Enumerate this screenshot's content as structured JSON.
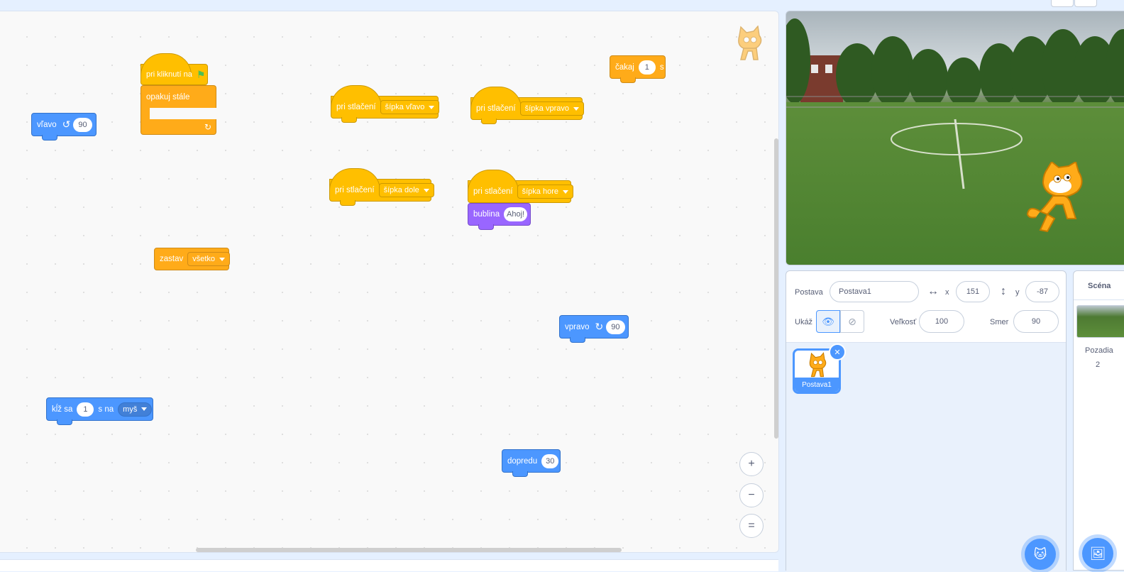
{
  "code_blocks": {
    "turn_left": {
      "label": "vľavo",
      "value": "90"
    },
    "when_flag": {
      "label": "pri kliknutí na"
    },
    "forever": {
      "label": "opakuj stále"
    },
    "wait": {
      "label": "čakaj",
      "value": "1",
      "unit": "s"
    },
    "key_left": {
      "label": "pri stlačení",
      "key": "šípka vľavo"
    },
    "key_right": {
      "label": "pri stlačení",
      "key": "šípka vpravo"
    },
    "key_down": {
      "label": "pri stlačení",
      "key": "šípka dole"
    },
    "key_up": {
      "label": "pri stlačení",
      "key": "šípka hore"
    },
    "say": {
      "label": "bublina",
      "value": "Ahoj!"
    },
    "stop": {
      "label": "zastav",
      "option": "všetko"
    },
    "turn_right": {
      "label": "vpravo",
      "value": "90"
    },
    "glide": {
      "label": "kĺž sa",
      "value": "1",
      "mid": "s na",
      "target": "myš"
    },
    "move": {
      "label": "dopredu",
      "value": "30"
    }
  },
  "zoom": {
    "in": "+",
    "out": "−",
    "reset": "="
  },
  "sprite_info": {
    "sprite_label": "Postava",
    "sprite_name": "Postava1",
    "x_label": "x",
    "x_value": "151",
    "y_label": "y",
    "y_value": "-87",
    "show_label": "Ukáž",
    "size_label": "Veľkosť",
    "size_value": "100",
    "direction_label": "Smer",
    "direction_value": "90"
  },
  "sprites": [
    {
      "name": "Postava1"
    }
  ],
  "stage_panel": {
    "title": "Scéna",
    "backdrops_label": "Pozadia",
    "backdrops_count": "2"
  },
  "colors": {
    "motion": "#4c97ff",
    "events": "#ffbf00",
    "control": "#ffab19",
    "looks": "#9966ff",
    "accent": "#4c97ff"
  }
}
